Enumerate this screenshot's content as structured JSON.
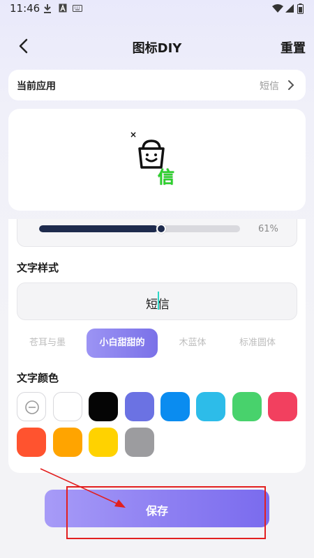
{
  "status_bar": {
    "time": "11:46",
    "left_icons": [
      "download-icon",
      "text-a-icon",
      "keyboard-icon"
    ],
    "right_icons": [
      "wifi-icon",
      "signal-icon",
      "battery-icon"
    ]
  },
  "header": {
    "title": "图标DIY",
    "reset_label": "重置"
  },
  "current_app": {
    "label": "当前应用",
    "value": "短信"
  },
  "preview": {
    "remove_glyph": "×",
    "icon": "shopping-bag-smile-icon",
    "overlay_text": "信",
    "overlay_color": "#2bd32b"
  },
  "slider": {
    "value_percent": 61,
    "value_label": "61%"
  },
  "text_style": {
    "title": "文字样式",
    "preview_text": "短信",
    "font_options": [
      {
        "label": "苍耳与墨",
        "active": false
      },
      {
        "label": "小白甜甜的",
        "active": true
      },
      {
        "label": "木蓝体",
        "active": false
      },
      {
        "label": "标准圆体",
        "active": false
      }
    ]
  },
  "text_color": {
    "title": "文字颜色",
    "swatches": [
      {
        "name": "none",
        "color": "#ffffff"
      },
      {
        "name": "white",
        "color": "#ffffff"
      },
      {
        "name": "black",
        "color": "#050505"
      },
      {
        "name": "indigo",
        "color": "#6b72e3"
      },
      {
        "name": "blue",
        "color": "#0a8cf0"
      },
      {
        "name": "sky",
        "color": "#2dbce9"
      },
      {
        "name": "green",
        "color": "#48d26c"
      },
      {
        "name": "pink-red",
        "color": "#f2405f"
      },
      {
        "name": "orange-red",
        "color": "#ff532f"
      },
      {
        "name": "orange",
        "color": "#ffa400"
      },
      {
        "name": "yellow",
        "color": "#ffd200"
      },
      {
        "name": "gray",
        "color": "#9c9c9f"
      }
    ]
  },
  "save": {
    "label": "保存"
  },
  "colors": {
    "accent": "#8d7ff2",
    "slider_fill": "#1e2b4d",
    "annotation": "#e21f1f"
  }
}
